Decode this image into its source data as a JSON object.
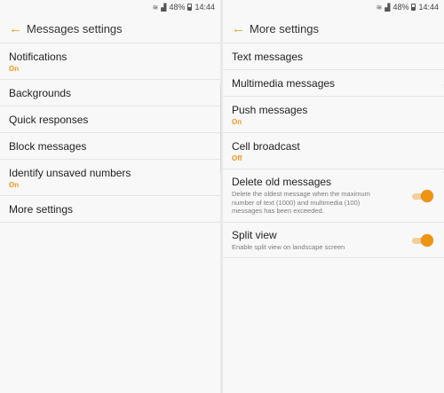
{
  "status": {
    "battery": "48%",
    "time": "14:44"
  },
  "left": {
    "title": "Messages settings",
    "items": [
      {
        "label": "Notifications",
        "sub": "On"
      },
      {
        "label": "Backgrounds"
      },
      {
        "label": "Quick responses"
      },
      {
        "label": "Block messages"
      },
      {
        "label": "Identify unsaved numbers",
        "sub": "On"
      },
      {
        "label": "More settings"
      }
    ]
  },
  "right": {
    "title": "More settings",
    "items": [
      {
        "label": "Text messages"
      },
      {
        "label": "Multimedia messages"
      },
      {
        "label": "Push messages",
        "sub": "On"
      },
      {
        "label": "Cell broadcast",
        "sub": "Off"
      }
    ],
    "toggles": [
      {
        "label": "Delete old messages",
        "desc": "Delete the oldest message when the maximum number of text (1000) and multimedia (100) messages has been exceeded.",
        "on": true
      },
      {
        "label": "Split view",
        "desc": "Enable split view on landscape screen",
        "on": true
      }
    ]
  },
  "colors": {
    "accent": "#e8962a",
    "switch_on": "#ec9416"
  }
}
